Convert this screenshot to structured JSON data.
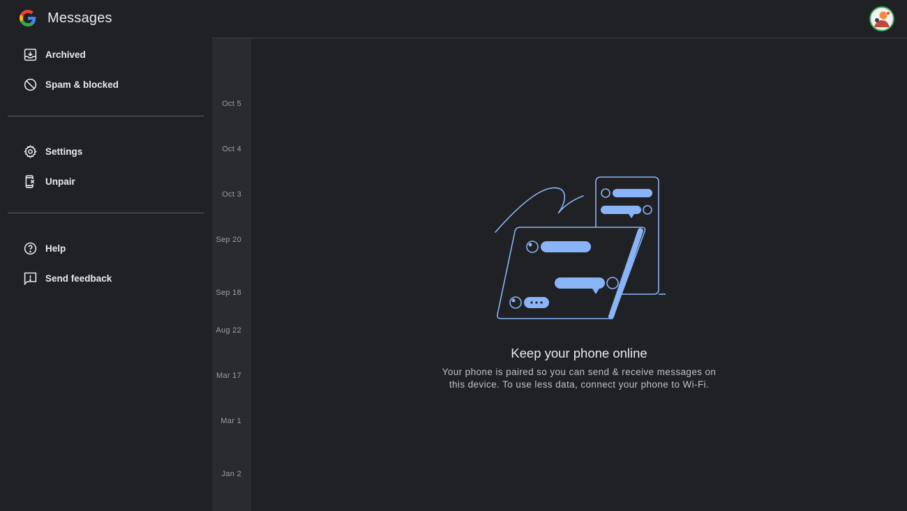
{
  "app": {
    "title": "Messages"
  },
  "menu": {
    "archived": "Archived",
    "spam": "Spam & blocked",
    "settings": "Settings",
    "unpair": "Unpair",
    "help": "Help",
    "feedback": "Send feedback"
  },
  "dates": [
    "Oct 5",
    "Oct 4",
    "Oct 3",
    "Sep 20",
    "Sep 18",
    "Aug 22",
    "Mar 17",
    "Mar 1",
    "Jan 2"
  ],
  "empty_state": {
    "headline": "Keep your phone online",
    "body": "Your phone is paired so you can send & receive messages on this device. To use less data, connect your phone to Wi-Fi."
  },
  "colors": {
    "background": "#202124",
    "accent": "#8ab4f8",
    "date_column": "#2a2b2f"
  },
  "icons": {
    "archived": "archive-icon",
    "spam": "block-icon",
    "settings": "gear-icon",
    "unpair": "unpair-phone-icon",
    "help": "help-icon",
    "feedback": "feedback-icon"
  }
}
